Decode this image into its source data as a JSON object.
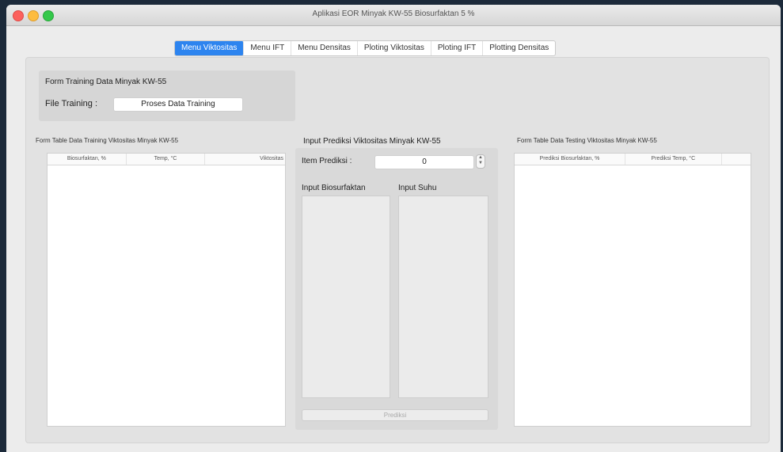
{
  "window": {
    "title": "Aplikasi EOR Minyak KW-55 Biosurfaktan 5 %"
  },
  "tabs": [
    {
      "label": "Menu Viktositas",
      "active": true
    },
    {
      "label": "Menu IFT",
      "active": false
    },
    {
      "label": "Menu Densitas",
      "active": false
    },
    {
      "label": "Ploting Viktositas",
      "active": false
    },
    {
      "label": "Ploting IFT",
      "active": false
    },
    {
      "label": "Plotting Densitas",
      "active": false
    }
  ],
  "training": {
    "title": "Form Training Data Minyak KW-55",
    "file_label": "File Training :",
    "process_button": "Proses Data Training"
  },
  "training_table": {
    "title": "Form Table Data Training Viktositas Minyak KW-55",
    "headers": [
      "Biosurfaktan, %",
      "Temp, °C",
      "Viktositas"
    ],
    "rows": []
  },
  "prediction": {
    "title": "Input Prediksi Viktositas Minyak KW-55",
    "item_label": "Item Prediksi :",
    "item_value": "0",
    "bio_label": "Input Biosurfaktan",
    "suhu_label": "Input Suhu",
    "predict_button": "Prediksi"
  },
  "testing_table": {
    "title": "Form Table Data Testing Viktositas Minyak KW-55",
    "headers": [
      "Prediksi Biosurfaktan, %",
      "Prediksi Temp, °C",
      ""
    ],
    "rows": []
  },
  "colors": {
    "accent": "#2d84ef",
    "background": "#ececec"
  }
}
